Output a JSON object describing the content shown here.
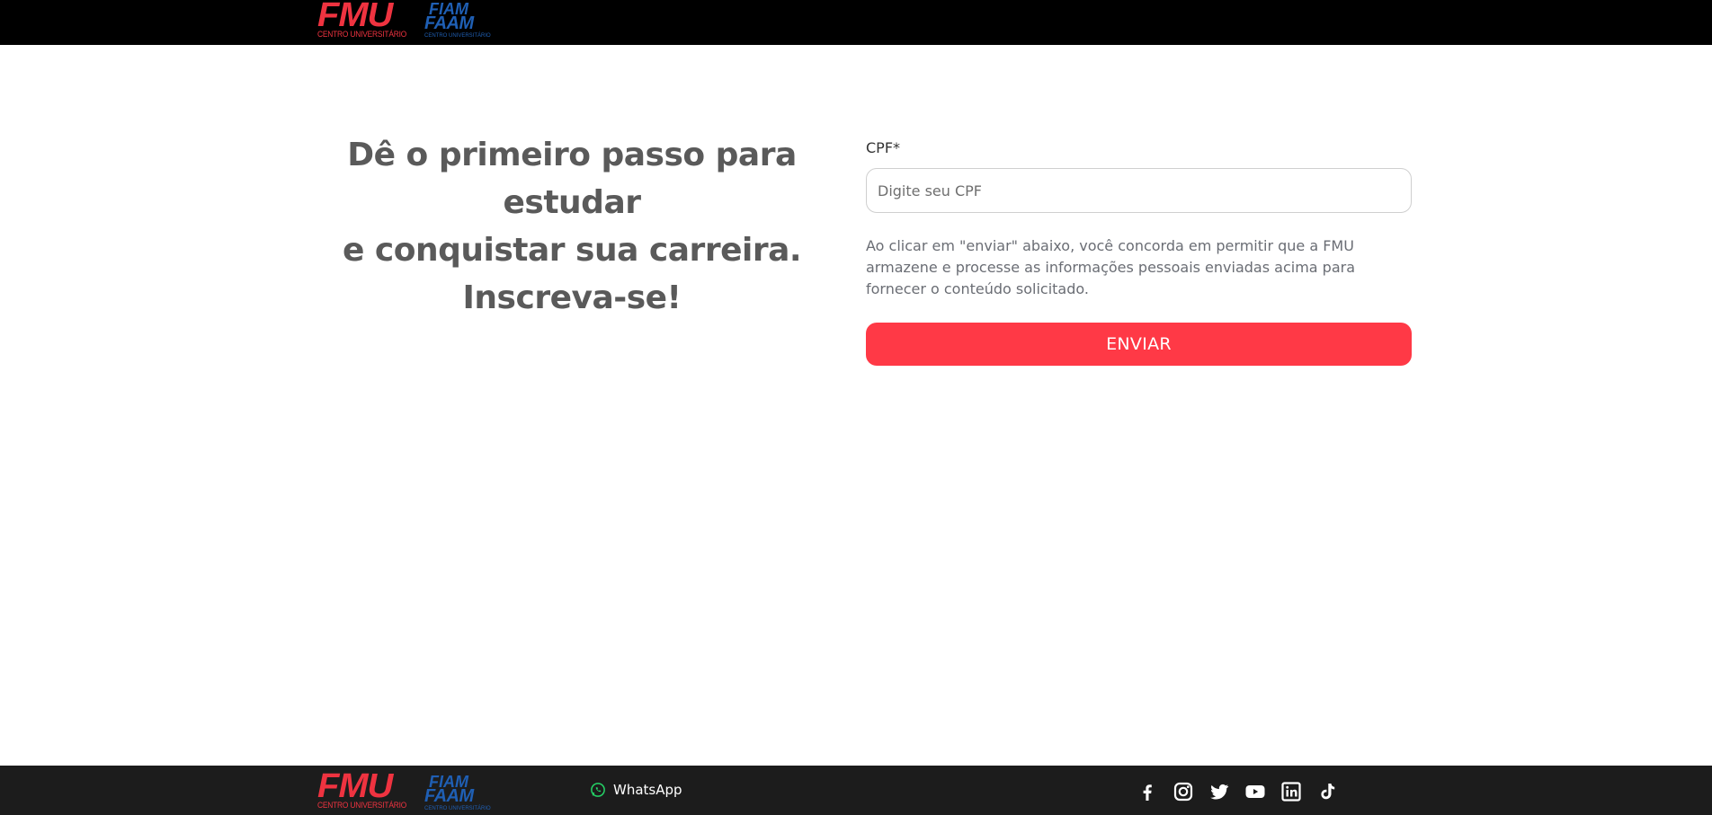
{
  "header": {
    "logo_primary": {
      "word": "FMU",
      "subtitle": "CENTRO UNIVERSITÁRIO"
    },
    "logo_secondary": {
      "word_top": "FIAM",
      "word_bottom": "FAAM",
      "subtitle": "CENTRO UNIVERSITÁRIO"
    }
  },
  "main": {
    "headline_line1": "Dê o primeiro passo para estudar",
    "headline_line2": "e conquistar sua carreira.",
    "headline_line3": "Inscreva-se!",
    "form": {
      "cpf_label": "CPF*",
      "cpf_placeholder": "Digite seu CPF",
      "cpf_value": "",
      "consent_text": "Ao clicar em \"enviar\" abaixo, você concorda em permitir que a FMU armazene e processe as informações pessoais enviadas acima para fornecer o conteúdo solicitado.",
      "submit_label": "ENVIAR"
    }
  },
  "footer": {
    "logo_primary": {
      "word": "FMU",
      "subtitle": "CENTRO UNIVERSITÁRIO"
    },
    "logo_secondary": {
      "word_top": "FIAM",
      "word_bottom": "FAAM",
      "subtitle": "CENTRO UNIVERSITÁRIO"
    },
    "whatsapp": {
      "icon": "whatsapp-icon",
      "label": "WhatsApp"
    },
    "social_icons": [
      "facebook-icon",
      "instagram-icon",
      "twitter-icon",
      "youtube-icon",
      "linkedin-icon",
      "tiktok-icon"
    ]
  },
  "colors": {
    "header_bg": "#000000",
    "footer_bg": "#1c1c1c",
    "fmu_red": "#ef3340",
    "fiam_blue": "#1f5fb4",
    "button_bg": "#ff3946",
    "headline_text": "#5a5a5a",
    "whatsapp_green": "#25d366"
  }
}
